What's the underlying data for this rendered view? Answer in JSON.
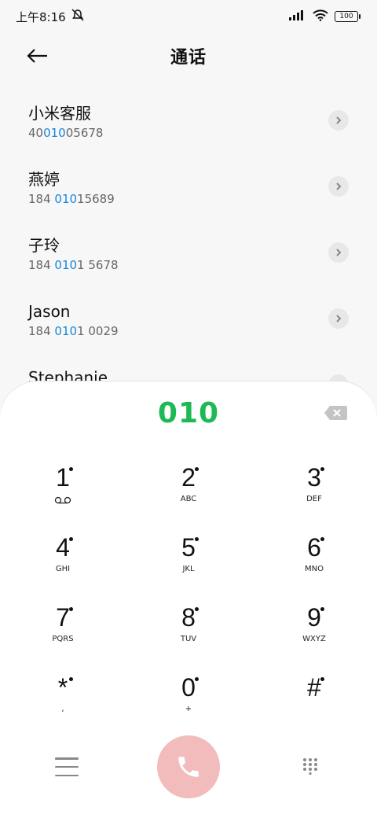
{
  "status_bar": {
    "time": "上午8:16",
    "battery": "100",
    "icons": [
      "dnd-icon",
      "signal-icon",
      "wifi-icon",
      "battery-icon"
    ]
  },
  "header": {
    "title": "通话",
    "back_icon": "arrow-left-icon"
  },
  "contacts": [
    {
      "name": "小米客服",
      "number_parts": [
        "40",
        "010",
        "05678"
      ]
    },
    {
      "name": "燕婷",
      "number_parts": [
        "184 ",
        "010",
        "15689"
      ]
    },
    {
      "name": "子玲",
      "number_parts": [
        "184 ",
        "010",
        "1 5678"
      ]
    },
    {
      "name": "Jason",
      "number_parts": [
        "184 ",
        "010",
        "1 0029"
      ]
    },
    {
      "name": "Stephanie",
      "number_parts": [
        "",
        "",
        ""
      ]
    }
  ],
  "dialer": {
    "input_value": "010",
    "keys": [
      {
        "digit": "1",
        "letters": ""
      },
      {
        "digit": "2",
        "letters": "ABC"
      },
      {
        "digit": "3",
        "letters": "DEF"
      },
      {
        "digit": "4",
        "letters": "GHI"
      },
      {
        "digit": "5",
        "letters": "JKL"
      },
      {
        "digit": "6",
        "letters": "MNO"
      },
      {
        "digit": "7",
        "letters": "PQRS"
      },
      {
        "digit": "8",
        "letters": "TUV"
      },
      {
        "digit": "9",
        "letters": "WXYZ"
      },
      {
        "digit": "*",
        "letters": ","
      },
      {
        "digit": "0",
        "letters": "+"
      },
      {
        "digit": "#",
        "letters": ""
      }
    ]
  },
  "colors": {
    "accent_green": "#1db954",
    "highlight_blue": "#1a86d6",
    "call_button": "#f2bcbc"
  }
}
